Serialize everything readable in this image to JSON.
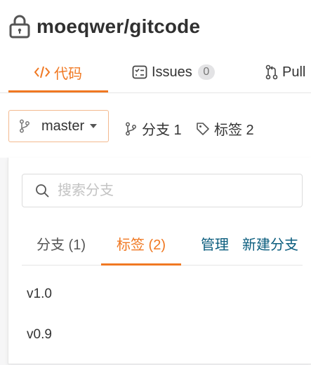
{
  "repo": {
    "title": "moeqwer/gitcode"
  },
  "tabs": {
    "code": {
      "label": "代码"
    },
    "issues": {
      "label": "Issues",
      "count": "0"
    },
    "pull": {
      "label": "Pull"
    }
  },
  "toolbar": {
    "branch_selector": {
      "value": "master"
    },
    "branches_link": {
      "label": "分支 1"
    },
    "tags_link": {
      "label": "标签 2"
    }
  },
  "dropdown": {
    "search": {
      "placeholder": "搜索分支",
      "value": ""
    },
    "tabs": {
      "branches": "分支 (1)",
      "tags": "标签 (2)",
      "manage": "管理",
      "new_branch": "新建分支"
    },
    "active_tab": "tags",
    "items": [
      {
        "label": "v1.0"
      },
      {
        "label": "v0.9"
      }
    ]
  },
  "colors": {
    "accent": "#f07822",
    "link": "#0b5d7e",
    "badge_bg": "#e3e3e5"
  },
  "icons": {
    "lock": "lock-icon",
    "code": "code-brackets-icon",
    "issues": "issue-list-icon",
    "pull": "pull-request-icon",
    "branch": "git-branch-icon",
    "tag": "tag-icon",
    "search": "search-icon"
  }
}
